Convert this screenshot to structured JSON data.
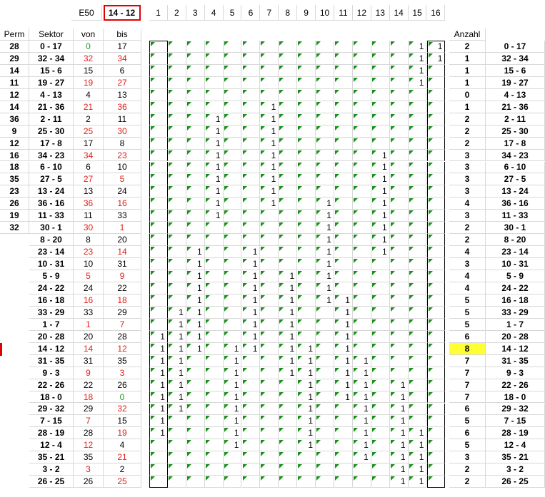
{
  "title_cell": "E50",
  "selected_value": "14 - 12",
  "headers": {
    "perm": "Perm",
    "sektor": "Sektor",
    "von": "von",
    "bis": "bis",
    "anzahl": "Anzahl",
    "cols": [
      "1",
      "2",
      "3",
      "4",
      "5",
      "6",
      "7",
      "8",
      "9",
      "10",
      "11",
      "12",
      "13",
      "14",
      "15",
      "16"
    ]
  },
  "perm": [
    "28",
    "29",
    "14",
    "11",
    "12",
    "14",
    "36",
    "9",
    "12",
    "16",
    "18",
    "35",
    "23",
    "26",
    "19",
    "32"
  ],
  "rows": [
    {
      "sektor": "0 - 17",
      "von": "0",
      "von_color": "green",
      "bis": "17",
      "bis_color": "black",
      "ones": [
        15,
        16
      ],
      "anzahl": "2",
      "right": "0 - 17"
    },
    {
      "sektor": "32 - 34",
      "von": "32",
      "von_color": "red",
      "bis": "34",
      "bis_color": "red",
      "ones": [
        15,
        16
      ],
      "anzahl": "1",
      "right": "32 - 34"
    },
    {
      "sektor": "15 - 6",
      "von": "15",
      "von_color": "black",
      "bis": "6",
      "bis_color": "black",
      "ones": [
        15
      ],
      "anzahl": "1",
      "right": "15 - 6"
    },
    {
      "sektor": "19 - 27",
      "von": "19",
      "von_color": "red",
      "bis": "27",
      "bis_color": "red",
      "ones": [
        15
      ],
      "anzahl": "1",
      "right": "19 - 27"
    },
    {
      "sektor": "4 - 13",
      "von": "4",
      "von_color": "black",
      "bis": "13",
      "bis_color": "black",
      "ones": [],
      "anzahl": "0",
      "right": "4 - 13"
    },
    {
      "sektor": "21 - 36",
      "von": "21",
      "von_color": "red",
      "bis": "36",
      "bis_color": "red",
      "ones": [
        7
      ],
      "anzahl": "1",
      "right": "21 - 36"
    },
    {
      "sektor": "2 - 11",
      "von": "2",
      "von_color": "black",
      "bis": "11",
      "bis_color": "black",
      "ones": [
        4,
        7
      ],
      "anzahl": "2",
      "right": "2 - 11"
    },
    {
      "sektor": "25 - 30",
      "von": "25",
      "von_color": "red",
      "bis": "30",
      "bis_color": "red",
      "ones": [
        4,
        7
      ],
      "anzahl": "2",
      "right": "25 - 30"
    },
    {
      "sektor": "17 - 8",
      "von": "17",
      "von_color": "black",
      "bis": "8",
      "bis_color": "black",
      "ones": [
        4,
        7
      ],
      "anzahl": "2",
      "right": "17 - 8"
    },
    {
      "sektor": "34 - 23",
      "von": "34",
      "von_color": "red",
      "bis": "23",
      "bis_color": "red",
      "ones": [
        4,
        7,
        13
      ],
      "anzahl": "3",
      "right": "34 - 23"
    },
    {
      "sektor": "6 - 10",
      "von": "6",
      "von_color": "black",
      "bis": "10",
      "bis_color": "black",
      "ones": [
        4,
        7,
        13
      ],
      "anzahl": "3",
      "right": "6 - 10"
    },
    {
      "sektor": "27 - 5",
      "von": "27",
      "von_color": "red",
      "bis": "5",
      "bis_color": "red",
      "ones": [
        4,
        7,
        13
      ],
      "anzahl": "3",
      "right": "27 - 5"
    },
    {
      "sektor": "13 - 24",
      "von": "13",
      "von_color": "black",
      "bis": "24",
      "bis_color": "black",
      "ones": [
        4,
        7,
        13
      ],
      "anzahl": "3",
      "right": "13 - 24"
    },
    {
      "sektor": "36 - 16",
      "von": "36",
      "von_color": "red",
      "bis": "16",
      "bis_color": "red",
      "ones": [
        4,
        7,
        10,
        13
      ],
      "anzahl": "4",
      "right": "36 - 16"
    },
    {
      "sektor": "11 - 33",
      "von": "11",
      "von_color": "black",
      "bis": "33",
      "bis_color": "black",
      "ones": [
        4,
        10,
        13
      ],
      "anzahl": "3",
      "right": "11 - 33"
    },
    {
      "sektor": "30 - 1",
      "von": "30",
      "von_color": "red",
      "bis": "1",
      "bis_color": "red",
      "ones": [
        10,
        13
      ],
      "anzahl": "2",
      "right": "30 - 1"
    },
    {
      "sektor": "8 - 20",
      "von": "8",
      "von_color": "black",
      "bis": "20",
      "bis_color": "black",
      "ones": [
        10,
        13
      ],
      "anzahl": "2",
      "right": "8 - 20"
    },
    {
      "sektor": "23 - 14",
      "von": "23",
      "von_color": "red",
      "bis": "14",
      "bis_color": "red",
      "ones": [
        3,
        6,
        10,
        13
      ],
      "anzahl": "4",
      "right": "23 - 14"
    },
    {
      "sektor": "10 - 31",
      "von": "10",
      "von_color": "black",
      "bis": "31",
      "bis_color": "black",
      "ones": [
        3,
        6,
        10
      ],
      "anzahl": "3",
      "right": "10 - 31"
    },
    {
      "sektor": "5 - 9",
      "von": "5",
      "von_color": "red",
      "bis": "9",
      "bis_color": "red",
      "ones": [
        3,
        6,
        8,
        10
      ],
      "anzahl": "4",
      "right": "5 - 9"
    },
    {
      "sektor": "24 - 22",
      "von": "24",
      "von_color": "black",
      "bis": "22",
      "bis_color": "black",
      "ones": [
        3,
        6,
        8,
        10
      ],
      "anzahl": "4",
      "right": "24 - 22"
    },
    {
      "sektor": "16 - 18",
      "von": "16",
      "von_color": "red",
      "bis": "18",
      "bis_color": "red",
      "ones": [
        3,
        6,
        8,
        10,
        11
      ],
      "anzahl": "5",
      "right": "16 - 18"
    },
    {
      "sektor": "33 - 29",
      "von": "33",
      "von_color": "black",
      "bis": "29",
      "bis_color": "black",
      "ones": [
        2,
        3,
        6,
        8,
        11
      ],
      "anzahl": "5",
      "right": "33 - 29"
    },
    {
      "sektor": "1 - 7",
      "von": "1",
      "von_color": "red",
      "bis": "7",
      "bis_color": "red",
      "ones": [
        2,
        3,
        6,
        8,
        11
      ],
      "anzahl": "5",
      "right": "1 - 7"
    },
    {
      "sektor": "20 - 28",
      "von": "20",
      "von_color": "black",
      "bis": "28",
      "bis_color": "black",
      "ones": [
        1,
        2,
        3,
        6,
        8,
        11
      ],
      "anzahl": "6",
      "right": "20 - 28"
    },
    {
      "sektor": "14 - 12",
      "von": "14",
      "von_color": "red",
      "bis": "12",
      "bis_color": "red",
      "ones": [
        1,
        2,
        3,
        5,
        6,
        8,
        9,
        11
      ],
      "anzahl": "8",
      "right": "14 - 12",
      "highlight": true
    },
    {
      "sektor": "31 - 35",
      "von": "31",
      "von_color": "black",
      "bis": "35",
      "bis_color": "black",
      "ones": [
        1,
        2,
        5,
        8,
        9,
        11,
        12
      ],
      "anzahl": "7",
      "right": "31 - 35"
    },
    {
      "sektor": "9 - 3",
      "von": "9",
      "von_color": "red",
      "bis": "3",
      "bis_color": "red",
      "ones": [
        1,
        2,
        5,
        8,
        9,
        11,
        12
      ],
      "anzahl": "7",
      "right": "9 - 3"
    },
    {
      "sektor": "22 - 26",
      "von": "22",
      "von_color": "black",
      "bis": "26",
      "bis_color": "black",
      "ones": [
        1,
        2,
        5,
        9,
        11,
        12,
        14
      ],
      "anzahl": "7",
      "right": "22 - 26"
    },
    {
      "sektor": "18 - 0",
      "von": "18",
      "von_color": "red",
      "bis": "0",
      "bis_color": "green",
      "ones": [
        1,
        2,
        5,
        9,
        11,
        12,
        14
      ],
      "anzahl": "7",
      "right": "18 - 0"
    },
    {
      "sektor": "29 - 32",
      "von": "29",
      "von_color": "black",
      "bis": "32",
      "bis_color": "red",
      "ones": [
        1,
        2,
        5,
        9,
        12,
        14
      ],
      "anzahl": "6",
      "right": "29 - 32"
    },
    {
      "sektor": "7 - 15",
      "von": "7",
      "von_color": "red",
      "bis": "15",
      "bis_color": "black",
      "ones": [
        1,
        5,
        9,
        12,
        14
      ],
      "anzahl": "5",
      "right": "7 - 15"
    },
    {
      "sektor": "28 - 19",
      "von": "28",
      "von_color": "black",
      "bis": "19",
      "bis_color": "red",
      "ones": [
        1,
        5,
        9,
        12,
        14,
        15
      ],
      "anzahl": "6",
      "right": "28 - 19"
    },
    {
      "sektor": "12 - 4",
      "von": "12",
      "von_color": "red",
      "bis": "4",
      "bis_color": "black",
      "ones": [
        5,
        9,
        12,
        14,
        15
      ],
      "anzahl": "5",
      "right": "12 - 4"
    },
    {
      "sektor": "35 - 21",
      "von": "35",
      "von_color": "black",
      "bis": "21",
      "bis_color": "red",
      "ones": [
        12,
        14,
        15
      ],
      "anzahl": "3",
      "right": "35 - 21"
    },
    {
      "sektor": "3 - 2",
      "von": "3",
      "von_color": "red",
      "bis": "2",
      "bis_color": "black",
      "ones": [
        14,
        15
      ],
      "anzahl": "2",
      "right": "3 - 2"
    },
    {
      "sektor": "26 - 25",
      "von": "26",
      "von_color": "black",
      "bis": "25",
      "bis_color": "red",
      "ones": [
        14,
        15
      ],
      "anzahl": "2",
      "right": "26 - 25"
    }
  ]
}
